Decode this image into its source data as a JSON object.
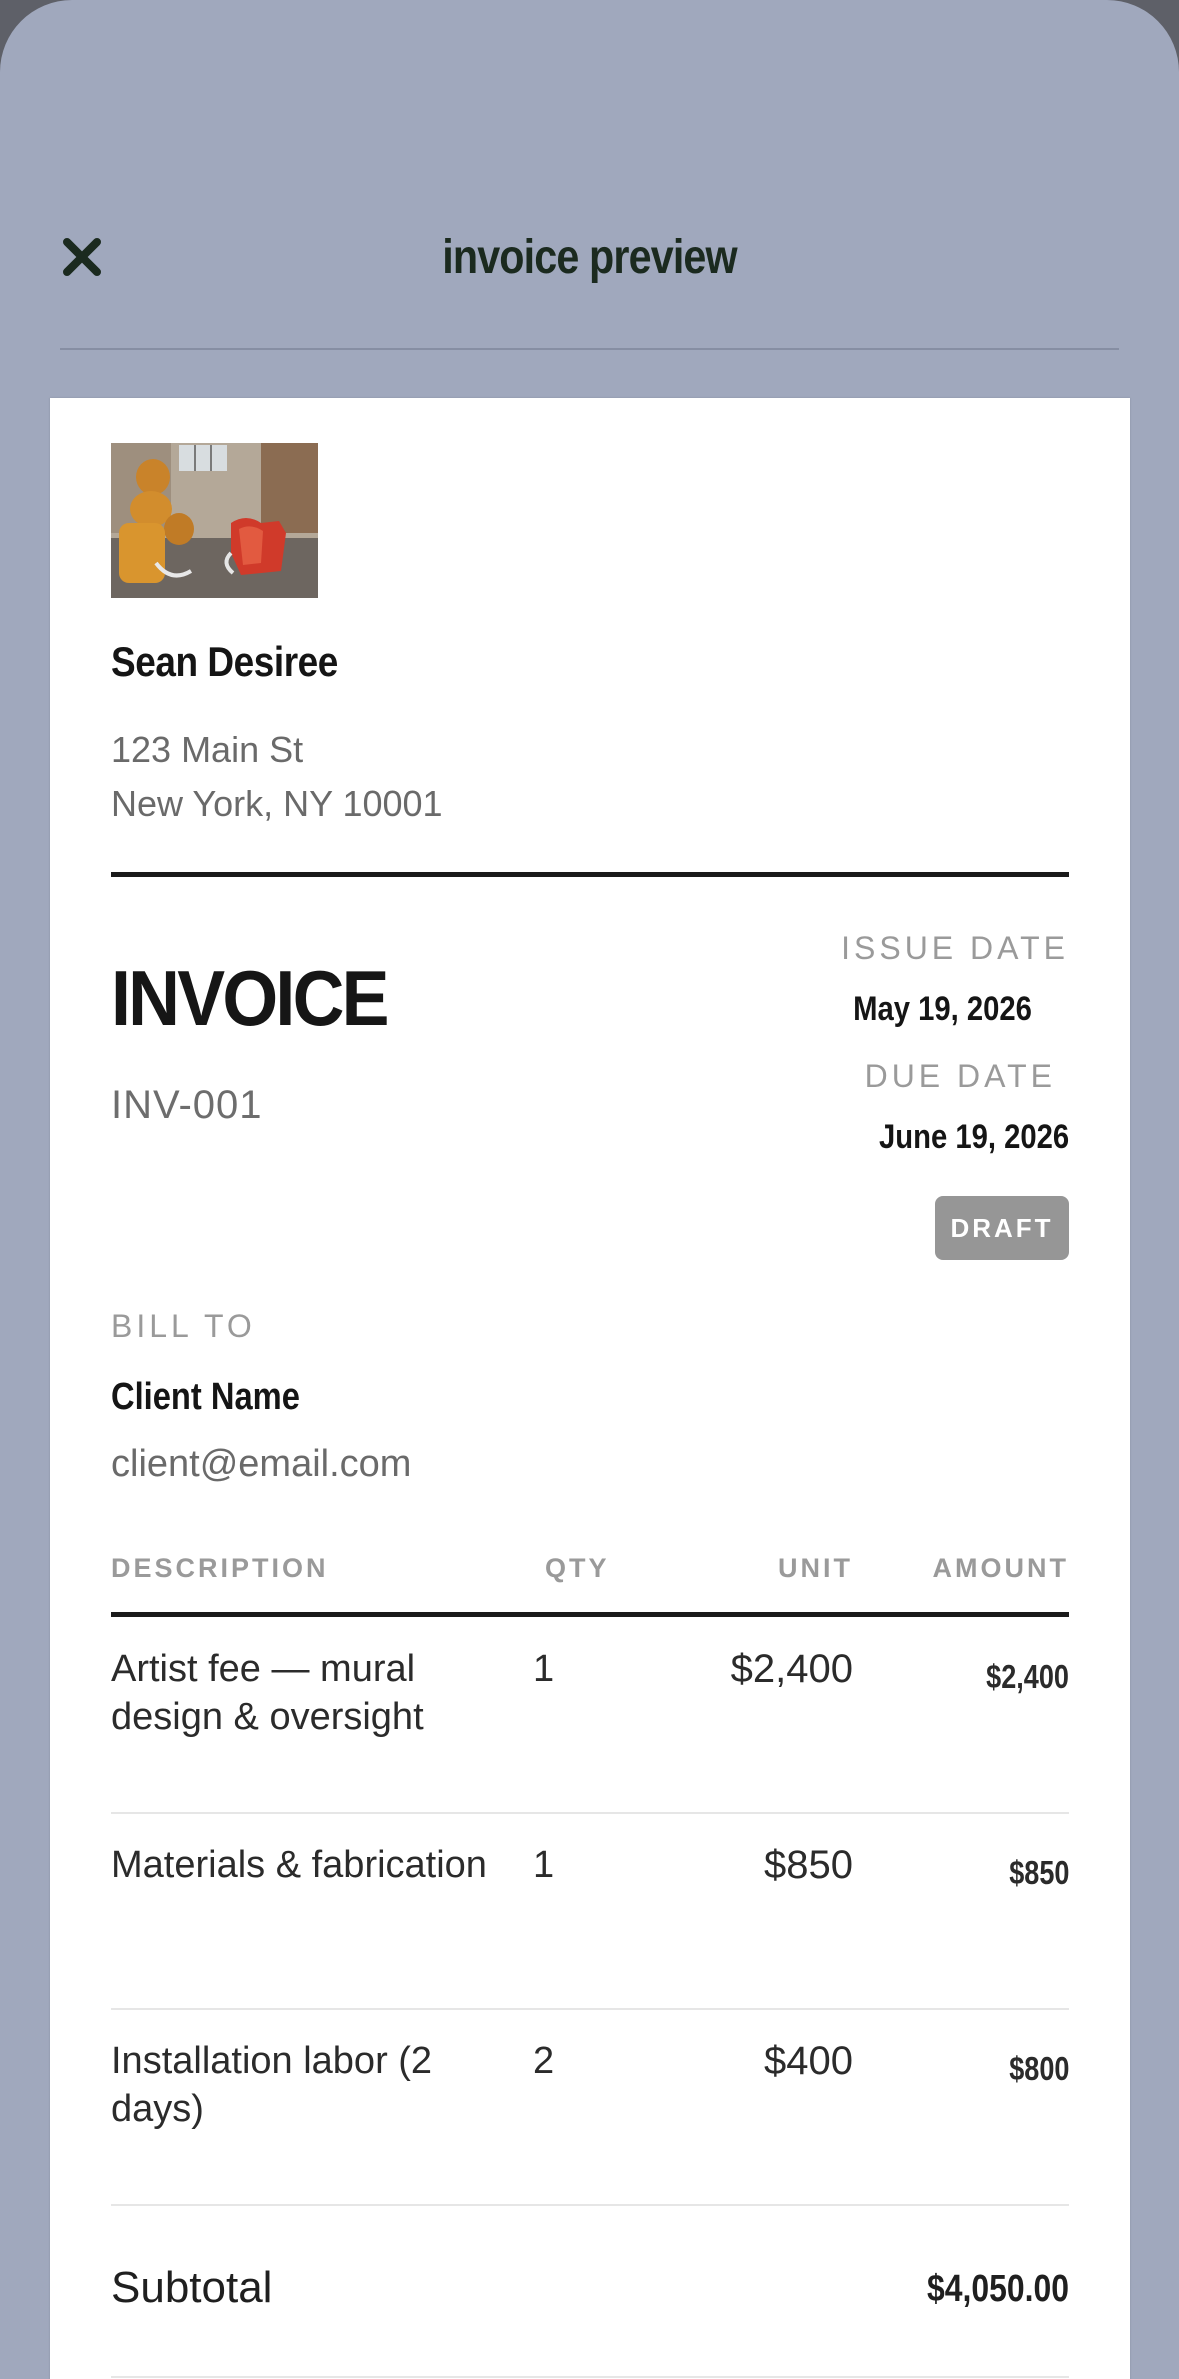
{
  "header": {
    "title": "invoice preview",
    "close_icon": "close-icon"
  },
  "business": {
    "logo": "artwork-photo",
    "name": "Sean Desiree",
    "address_line1": "123 Main St",
    "address_line2": "New York, NY 10001"
  },
  "invoice": {
    "heading": "INVOICE",
    "number": "INV-001",
    "issue_date_label": "ISSUE DATE",
    "issue_date": "May 19, 2026",
    "due_date_label": "DUE DATE",
    "due_date": "June 19, 2026",
    "status": "DRAFT"
  },
  "bill_to": {
    "label": "BILL TO",
    "client_name": "Client Name",
    "client_email": "client@email.com"
  },
  "table": {
    "headers": {
      "description": "DESCRIPTION",
      "qty": "QTY",
      "unit": "UNIT",
      "amount": "AMOUNT"
    },
    "rows": [
      {
        "description": "Artist fee — mural design & oversight",
        "qty": "1",
        "unit": "$2,400",
        "amount": "$2,400"
      },
      {
        "description": "Materials & fabrication",
        "qty": "1",
        "unit": "$850",
        "amount": "$850"
      },
      {
        "description": "Installation labor (2 days)",
        "qty": "2",
        "unit": "$400",
        "amount": "$800"
      }
    ]
  },
  "totals": {
    "subtotal_label": "Subtotal",
    "subtotal": "$4,050.00"
  },
  "colors": {
    "sheet_background": "#a0a8bd",
    "title_text": "#1b2a1f",
    "badge": "#969696"
  }
}
